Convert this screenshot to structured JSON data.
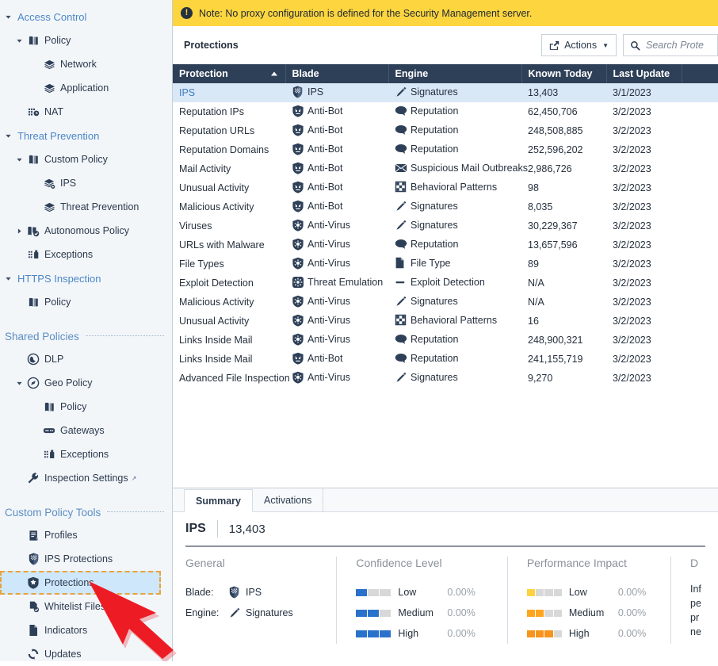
{
  "sidebar": {
    "groups": [
      {
        "type": "group",
        "label": "Access Control",
        "icon": "chevron-down-icon",
        "level": 0,
        "children": [
          {
            "label": "Policy",
            "icon": "policy-book-icon",
            "level": 1,
            "twisty": "chevron-down-icon"
          },
          {
            "label": "Network",
            "icon": "layers-icon",
            "level": 2,
            "twisty": ""
          },
          {
            "label": "Application",
            "icon": "layers-icon",
            "level": 2,
            "twisty": ""
          },
          {
            "label": "NAT",
            "icon": "nat-icon",
            "level": 1,
            "twisty": ""
          }
        ]
      },
      {
        "type": "group",
        "label": "Threat Prevention",
        "icon": "chevron-down-icon",
        "level": 0,
        "children": [
          {
            "label": "Custom Policy",
            "icon": "policy-book-icon",
            "level": 1,
            "twisty": "chevron-down-icon"
          },
          {
            "label": "IPS",
            "icon": "layers-ips-icon",
            "level": 2,
            "twisty": ""
          },
          {
            "label": "Threat Prevention",
            "icon": "layers-icon",
            "level": 2,
            "twisty": ""
          },
          {
            "label": "Autonomous Policy",
            "icon": "policy-check-icon",
            "level": 1,
            "twisty": "chevron-right-icon"
          },
          {
            "label": "Exceptions",
            "icon": "exceptions-icon",
            "level": 1,
            "twisty": ""
          }
        ]
      },
      {
        "type": "group",
        "label": "HTTPS Inspection",
        "icon": "chevron-down-icon",
        "level": 0,
        "children": [
          {
            "label": "Policy",
            "icon": "policy-book-icon",
            "level": 1,
            "twisty": ""
          }
        ]
      }
    ],
    "sections": [
      {
        "title": "Shared Policies",
        "items": [
          {
            "label": "DLP",
            "icon": "dlp-icon",
            "level": 1,
            "twisty": ""
          },
          {
            "label": "Geo Policy",
            "icon": "geo-policy-icon",
            "level": 1,
            "twisty": "chevron-down-icon"
          },
          {
            "label": "Policy",
            "icon": "policy-book-icon",
            "level": 2,
            "twisty": ""
          },
          {
            "label": "Gateways",
            "icon": "gateway-icon",
            "level": 2,
            "twisty": ""
          },
          {
            "label": "Exceptions",
            "icon": "exceptions-icon",
            "level": 2,
            "twisty": ""
          },
          {
            "label": "Inspection Settings",
            "icon": "wrench-icon",
            "level": 1,
            "twisty": "",
            "external": "↗"
          }
        ]
      },
      {
        "title": "Custom Policy Tools",
        "items": [
          {
            "label": "Profiles",
            "icon": "profiles-icon",
            "level": 1,
            "twisty": ""
          },
          {
            "label": "IPS Protections",
            "icon": "ips-shield-icon",
            "level": 1,
            "twisty": ""
          },
          {
            "label": "Protections",
            "icon": "protections-shield-icon",
            "level": 1,
            "twisty": "",
            "selected": true
          },
          {
            "label": "Whitelist Files",
            "icon": "whitelist-files-icon",
            "level": 1,
            "twisty": ""
          },
          {
            "label": "Indicators",
            "icon": "indicators-icon",
            "level": 1,
            "twisty": ""
          },
          {
            "label": "Updates",
            "icon": "updates-icon",
            "level": 1,
            "twisty": ""
          }
        ]
      }
    ]
  },
  "note": {
    "icon": "info-exclamation-icon",
    "text": "Note: No proxy configuration is defined for the Security Management server."
  },
  "toolbar": {
    "title": "Protections",
    "actions_label": "Actions",
    "actions_icon": "share-actions-icon",
    "search_icon": "search-icon",
    "search_placeholder": "Search Prote",
    "search_value": ""
  },
  "table": {
    "columns": [
      {
        "label": "Protection",
        "sorted": "asc"
      },
      {
        "label": "Blade",
        "sorted": ""
      },
      {
        "label": "Engine",
        "sorted": ""
      },
      {
        "label": "Known Today",
        "sorted": ""
      },
      {
        "label": "Last Update",
        "sorted": ""
      },
      {
        "label": "",
        "sorted": ""
      }
    ],
    "rows": [
      {
        "protection": "IPS",
        "blade": "IPS",
        "blade_icon": "ips-shield-icon",
        "engine": "Signatures",
        "engine_icon": "pencil-icon",
        "known_today": "13,403",
        "last_update": "3/1/2023",
        "selected": true,
        "link": true
      },
      {
        "protection": "Reputation IPs",
        "blade": "Anti-Bot",
        "blade_icon": "anti-bot-icon",
        "engine": "Reputation",
        "engine_icon": "bubble-icon",
        "known_today": "62,450,706",
        "last_update": "3/2/2023",
        "selected": false,
        "link": false
      },
      {
        "protection": "Reputation URLs",
        "blade": "Anti-Bot",
        "blade_icon": "anti-bot-icon",
        "engine": "Reputation",
        "engine_icon": "bubble-icon",
        "known_today": "248,508,885",
        "last_update": "3/2/2023",
        "selected": false,
        "link": false
      },
      {
        "protection": "Reputation Domains",
        "blade": "Anti-Bot",
        "blade_icon": "anti-bot-icon",
        "engine": "Reputation",
        "engine_icon": "bubble-icon",
        "known_today": "252,596,202",
        "last_update": "3/2/2023",
        "selected": false,
        "link": false
      },
      {
        "protection": "Mail Activity",
        "blade": "Anti-Bot",
        "blade_icon": "anti-bot-icon",
        "engine": "Suspicious Mail Outbreaks",
        "engine_icon": "envelope-icon",
        "known_today": "2,986,726",
        "last_update": "3/2/2023",
        "selected": false,
        "link": false
      },
      {
        "protection": "Unusual Activity",
        "blade": "Anti-Bot",
        "blade_icon": "anti-bot-icon",
        "engine": "Behavioral Patterns",
        "engine_icon": "checker-square-icon",
        "known_today": "98",
        "last_update": "3/2/2023",
        "selected": false,
        "link": true
      },
      {
        "protection": "Malicious Activity",
        "blade": "Anti-Bot",
        "blade_icon": "anti-bot-icon",
        "engine": "Signatures",
        "engine_icon": "pencil-icon",
        "known_today": "8,035",
        "last_update": "3/2/2023",
        "selected": false,
        "link": true
      },
      {
        "protection": "Viruses",
        "blade": "Anti-Virus",
        "blade_icon": "anti-virus-icon",
        "engine": "Signatures",
        "engine_icon": "pencil-icon",
        "known_today": "30,229,367",
        "last_update": "3/2/2023",
        "selected": false,
        "link": false
      },
      {
        "protection": "URLs with Malware",
        "blade": "Anti-Virus",
        "blade_icon": "anti-virus-icon",
        "engine": "Reputation",
        "engine_icon": "bubble-icon",
        "known_today": "13,657,596",
        "last_update": "3/2/2023",
        "selected": false,
        "link": false
      },
      {
        "protection": "File Types",
        "blade": "Anti-Virus",
        "blade_icon": "anti-virus-icon",
        "engine": "File Type",
        "engine_icon": "file-icon",
        "known_today": "89",
        "last_update": "3/2/2023",
        "selected": false,
        "link": false
      },
      {
        "protection": "Exploit Detection",
        "blade": "Threat Emulation",
        "blade_icon": "threat-emulation-icon",
        "engine": "Exploit Detection",
        "engine_icon": "dash-icon",
        "known_today": "N/A",
        "last_update": "3/2/2023",
        "selected": false,
        "link": false
      },
      {
        "protection": "Malicious Activity",
        "blade": "Anti-Virus",
        "blade_icon": "anti-virus-icon",
        "engine": "Signatures",
        "engine_icon": "pencil-icon",
        "known_today": "N/A",
        "last_update": "3/2/2023",
        "selected": false,
        "link": false
      },
      {
        "protection": "Unusual Activity",
        "blade": "Anti-Virus",
        "blade_icon": "anti-virus-icon",
        "engine": "Behavioral Patterns",
        "engine_icon": "checker-square-icon",
        "known_today": "16",
        "last_update": "3/2/2023",
        "selected": false,
        "link": true
      },
      {
        "protection": "Links Inside Mail",
        "blade": "Anti-Virus",
        "blade_icon": "anti-virus-icon",
        "engine": "Reputation",
        "engine_icon": "bubble-icon",
        "known_today": "248,900,321",
        "last_update": "3/2/2023",
        "selected": false,
        "link": false
      },
      {
        "protection": "Links Inside Mail",
        "blade": "Anti-Bot",
        "blade_icon": "anti-bot-icon",
        "engine": "Reputation",
        "engine_icon": "bubble-icon",
        "known_today": "241,155,719",
        "last_update": "3/2/2023",
        "selected": false,
        "link": false
      },
      {
        "protection": "Advanced File Inspection",
        "blade": "Anti-Virus",
        "blade_icon": "anti-virus-icon",
        "engine": "Signatures",
        "engine_icon": "pencil-icon",
        "known_today": "9,270",
        "last_update": "3/2/2023",
        "selected": false,
        "link": false
      }
    ]
  },
  "details": {
    "tabs": [
      {
        "label": "Summary",
        "active": true
      },
      {
        "label": "Activations",
        "active": false
      }
    ],
    "name": "IPS",
    "count": "13,403",
    "general": {
      "title": "General",
      "blade_key": "Blade:",
      "blade_value": "IPS",
      "blade_icon": "ips-shield-icon",
      "engine_key": "Engine:",
      "engine_value": "Signatures",
      "engine_icon": "pencil-icon"
    },
    "confidence": {
      "title": "Confidence Level",
      "segments": 3,
      "color": "#2a71cc",
      "rows": [
        {
          "label": "Low",
          "percent": "0.00%",
          "filled": 1
        },
        {
          "label": "Medium",
          "percent": "0.00%",
          "filled": 2
        },
        {
          "label": "High",
          "percent": "0.00%",
          "filled": 3
        }
      ]
    },
    "performance": {
      "title": "Performance Impact",
      "segments": 4,
      "rows": [
        {
          "label": "Low",
          "percent": "0.00%",
          "filled": 1,
          "color": "#ffd23f"
        },
        {
          "label": "Medium",
          "percent": "0.00%",
          "filled": 2,
          "color": "#ffa51f"
        },
        {
          "label": "High",
          "percent": "0.00%",
          "filled": 3,
          "color": "#f7941e"
        }
      ]
    },
    "description": {
      "title": "D",
      "lines": [
        "Inf",
        "pe",
        "pr",
        "ne"
      ]
    }
  },
  "annotation": {
    "arrow_color": "#ed1c24",
    "highlight_border": "#e8a33d",
    "highlight_fill": "#cfe7fa"
  }
}
